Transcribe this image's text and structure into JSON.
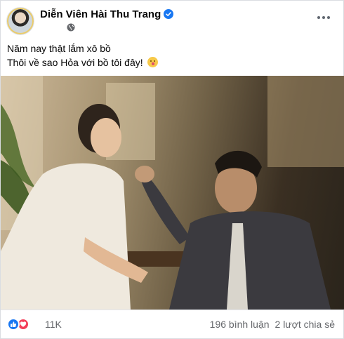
{
  "post": {
    "author": "Diễn Viên Hài Thu Trang",
    "verified": true,
    "privacy_icon": "globe-icon",
    "text_lines": [
      "Năm nay thật lắm xô bồ",
      "Thôi về sao Hỏa với bồ tôi đây!"
    ],
    "emoji": "grinning-face-with-tongue"
  },
  "footer": {
    "reaction_icons": [
      "like-icon",
      "love-icon"
    ],
    "reaction_count": "11K",
    "comments": "196 bình luận",
    "shares": "2 lượt chia sẻ"
  },
  "colors": {
    "brand_blue": "#1877f2",
    "love_red": "#f33e58",
    "secondary_text": "#65676b"
  }
}
